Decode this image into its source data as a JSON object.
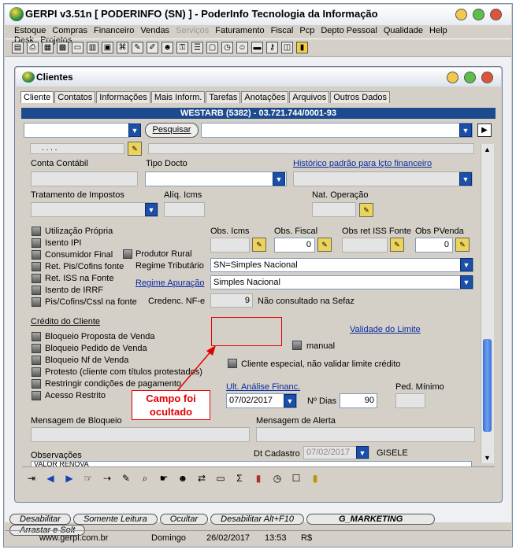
{
  "app": {
    "title": "GERPI v3.51n  [ PODERINFO (SN) ] - PoderInfo Tecnologia da Informação"
  },
  "menu": [
    "Estoque",
    "Compras",
    "Financeiro",
    "Vendas",
    "Serviços",
    "Faturamento",
    "Fiscal",
    "Pcp",
    "Depto Pessoal",
    "Qualidade",
    "Help Desk",
    "Projetos"
  ],
  "child": {
    "title": "Clientes"
  },
  "tabs": [
    "Cliente",
    "Contatos",
    "Informações",
    "Mais Inform.",
    "Tarefas",
    "Anotações",
    "Arquivos",
    "Outros Dados"
  ],
  "header": "WESTARB  (5382) - 03.721.744/0001-93",
  "search": {
    "button": "Pesquisar"
  },
  "top_field": ". . . .",
  "labels": {
    "conta_contabil": "Conta Contábil",
    "tipo_docto": "Tipo Docto",
    "historico": "Histórico padrão para lçto financeiro",
    "tratamento": "Tratamento de Impostos",
    "aliq_icms": "Alíq. Icms",
    "nat_operacao": "Nat. Operação",
    "obs_icms": "Obs. Icms",
    "obs_fiscal": "Obs. Fiscal",
    "obs_ret_iss": "Obs ret ISS Fonte",
    "obs_pvenda": "Obs PVenda",
    "regime_tributario": "Regime Tributário",
    "regime_apuracao": "Regime Apuração",
    "credenc_nfe": "Credenc. NF-e",
    "credito": "Crédito do Cliente",
    "validade_limite": "Validade do Limite",
    "manual": "manual",
    "cliente_especial": "Cliente especial, não validar limite crédito",
    "ult_analise": "Ult. Análise Financ.",
    "nr_dias": "Nº Dias",
    "ped_minimo": "Ped. Mínimo",
    "msg_bloqueio": "Mensagem de Bloqueio",
    "msg_alerta": "Mensagem de Alerta",
    "observacoes": "Observações",
    "dt_cadastro": "Dt Cadastro"
  },
  "checkboxes_left": [
    "Utilização Própria",
    "Isento IPI",
    "Consumidor Final",
    "Ret. Pis/Cofins fonte",
    "Ret. ISS na Fonte",
    "Isento de IRRF",
    "Pis/Cofins/Cssl na fonte"
  ],
  "produtor_rural": "Produtor Rural",
  "credito_checks": [
    "Bloqueio Proposta de Venda",
    "Bloqueio Pedido de Venda",
    "Bloqueio Nf de Venda",
    "Protesto (cliente com títulos protestados)",
    "Restringir condições de pagamento",
    "Acesso Restrito"
  ],
  "values": {
    "obs_fiscal": "0",
    "obs_pvenda": "0",
    "regime_tributario": "SN=Simples Nacional",
    "regime_apuracao": "Simples Nacional",
    "credenc_nfe": "9",
    "credenc_status": "Não consultado na Sefaz",
    "ult_analise": "07/02/2017",
    "nr_dias": "90",
    "dt_cadastro": "07/02/2017",
    "usuario": "GISELE",
    "obs_partial": "VALOR RENOVA"
  },
  "annotation": {
    "text": "Campo foi ocultado",
    "color": "#e00000"
  },
  "status_buttons": [
    "Desabilitar",
    "Somente Leitura",
    "Ocultar",
    "Desabilitar Alt+F10",
    "G_MARKETING",
    "Arrastar e Solt"
  ],
  "statusbar": {
    "site": "www.gerpi.com.br",
    "day": "Domingo",
    "date": "26/02/2017",
    "time": "13:53",
    "currency": "R$"
  }
}
